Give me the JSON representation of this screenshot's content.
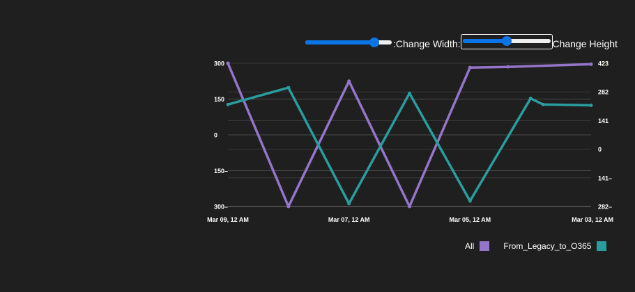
{
  "controls": {
    "width_label": ":Change Width:",
    "height_label": "Change Height",
    "width_value": 0.8,
    "height_value": 0.5
  },
  "chart_data": {
    "type": "line",
    "x": [
      "Mar 09, 12 AM",
      "Mar 08, 12 AM",
      "Mar 07, 12 AM",
      "Mar 06, 12 AM",
      "Mar 05, 12 AM",
      "Mar 04, 12 AM",
      "Mar 03, 12 AM"
    ],
    "x_tick_labels": [
      "Mar 09, 12 AM",
      "Mar 07, 12 AM",
      "Mar 05, 12 AM",
      "Mar 03, 12 AM"
    ],
    "y_left": {
      "ticks": [
        300,
        150,
        0,
        -150,
        -300
      ],
      "tick_labels": [
        "300",
        "150",
        "0",
        "150–",
        "300–"
      ],
      "ylim": [
        -300,
        300
      ]
    },
    "y_right": {
      "ticks": [
        423,
        282,
        141,
        0,
        -141,
        -282
      ],
      "tick_labels": [
        "423",
        "282",
        "141",
        "0",
        "141–",
        "282–"
      ],
      "ylim": [
        -282,
        423
      ]
    },
    "series": [
      {
        "name": "All",
        "color": "#9575c9",
        "axis": "left",
        "points": [
          {
            "x": "Mar 09, 12 AM",
            "y": 300
          },
          {
            "x": "Mar 08, 12 AM",
            "y": -300
          },
          {
            "x": "Mar 07, 12 AM",
            "y": 225
          },
          {
            "x": "Mar 06, 12 AM",
            "y": -300
          },
          {
            "x": "Mar 05, 12 AM",
            "y": 282
          },
          {
            "x": "Mar 04, 09 AM",
            "y": 285
          },
          {
            "x": "Mar 03, 12 AM",
            "y": 296
          }
        ]
      },
      {
        "name": "From_Legacy_to_O365",
        "color": "#2a9d9f",
        "axis": "right",
        "points": [
          {
            "x": "Mar 09, 12 AM",
            "y": 220
          },
          {
            "x": "Mar 08, 12 AM",
            "y": 303
          },
          {
            "x": "Mar 07, 12 AM",
            "y": -268
          },
          {
            "x": "Mar 06, 12 AM",
            "y": 275
          },
          {
            "x": "Mar 05, 12 AM",
            "y": -255
          },
          {
            "x": "Mar 04, 12 AM",
            "y": 250
          },
          {
            "x": "Mar 03, 19 AM",
            "y": 220
          },
          {
            "x": "Mar 03, 12 AM",
            "y": 216
          }
        ]
      }
    ],
    "grid": true,
    "legend": "bottom-right"
  }
}
